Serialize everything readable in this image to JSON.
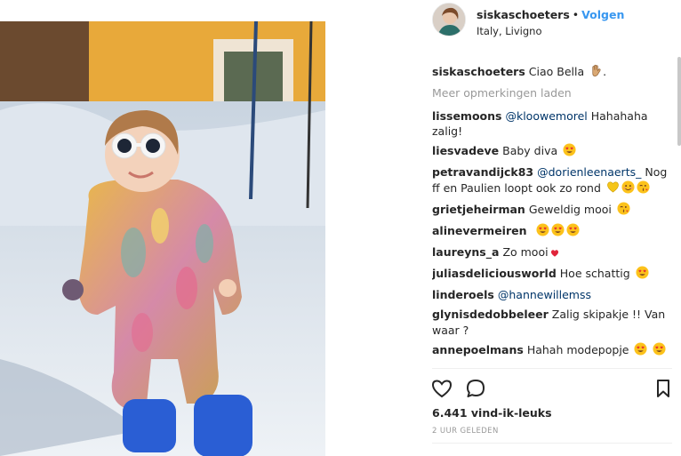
{
  "post": {
    "username": "siskaschoeters",
    "separator": "•",
    "follow_label": "Volgen",
    "location": "Italy, Livigno",
    "caption": {
      "user": "siskaschoeters",
      "text": "Ciao Bella"
    },
    "load_more": "Meer opmerkingen laden",
    "comments": [
      {
        "user": "lissemoons",
        "mention": "@kloowemorel",
        "text": " Hahahaha zalig!",
        "emoji": []
      },
      {
        "user": "liesvadeve",
        "mention": "",
        "text": "Baby diva",
        "emoji": [
          "heart-eyes"
        ]
      },
      {
        "user": "petravandijck83",
        "mention": "@dorienleenaerts_",
        "text": " Nog ff en Paulien loopt ook zo rond",
        "emoji": [
          "yellow-heart",
          "smile",
          "kiss"
        ]
      },
      {
        "user": "grietjeheirman",
        "mention": "",
        "text": "Geweldig mooi",
        "emoji": [
          "kiss"
        ]
      },
      {
        "user": "alinevermeiren",
        "mention": "",
        "text": "",
        "emoji": [
          "heart-eyes",
          "heart-eyes",
          "heart-eyes"
        ]
      },
      {
        "user": "laureyns_a",
        "mention": "",
        "text": "Zo mooi",
        "emoji": [
          "red-heart"
        ]
      },
      {
        "user": "juliasdeliciousworld",
        "mention": "",
        "text": "Hoe schattig",
        "emoji": [
          "heart-eyes"
        ]
      },
      {
        "user": "linderoels",
        "mention": "@hannewillemss",
        "text": "",
        "emoji": []
      },
      {
        "user": "glynisdedobbeleer",
        "mention": "",
        "text": "Zalig skipakje !! Van waar ?",
        "emoji": []
      },
      {
        "user": "annepoelmans",
        "mention": "",
        "text": "Hahah modepopje",
        "emoji": [
          "heart-eyes",
          "heart-eyes"
        ]
      }
    ],
    "likes": "6.441 vind-ik-leuks",
    "timestamp": "2 UUR GELEDEN",
    "icons": {
      "like": "heart-outline-icon",
      "comment": "speech-bubble-icon",
      "save": "bookmark-icon"
    },
    "colors": {
      "link": "#3897f0",
      "mention": "#003569",
      "muted": "#999999",
      "text": "#262626"
    }
  }
}
